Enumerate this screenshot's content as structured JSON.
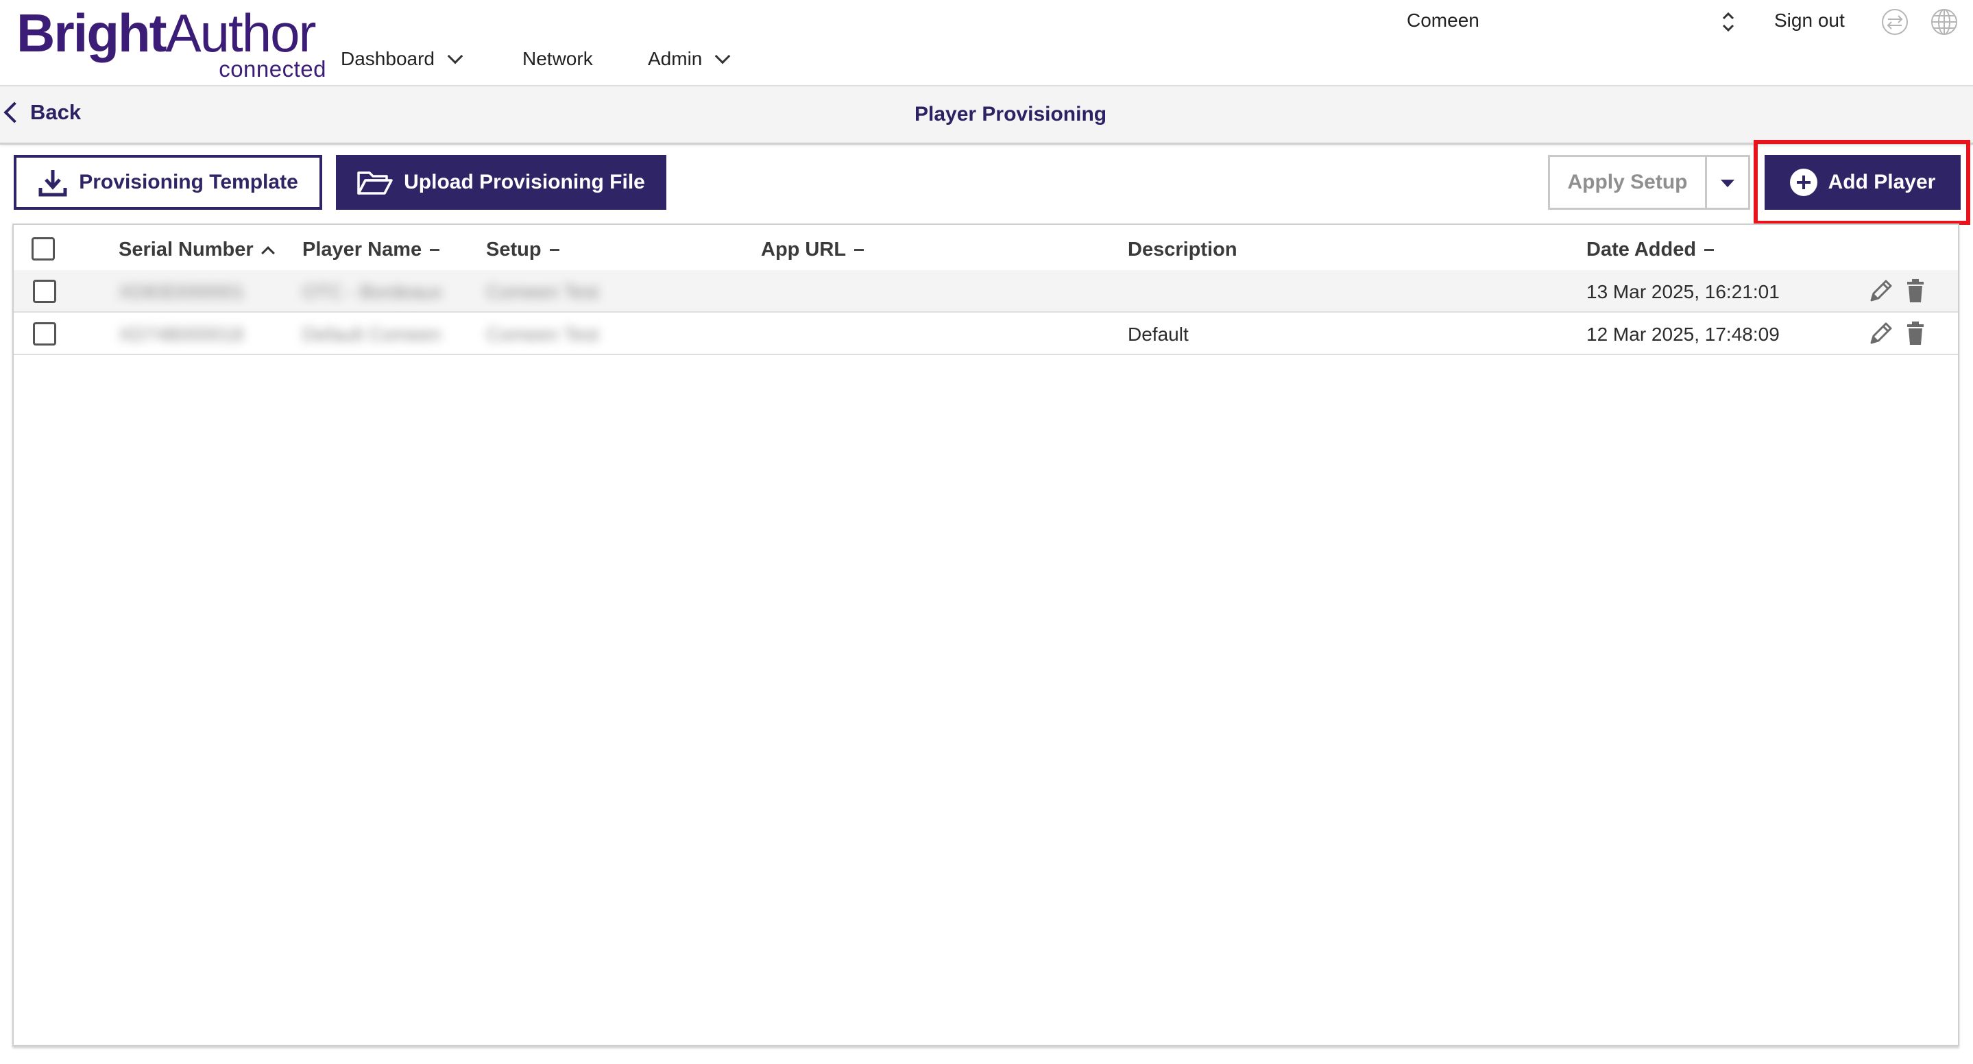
{
  "header": {
    "logo_bold": "Bright",
    "logo_light": "Author",
    "logo_sub": "connected",
    "nav": [
      {
        "label": "Dashboard",
        "dropdown": true
      },
      {
        "label": "Network",
        "dropdown": false
      },
      {
        "label": "Admin",
        "dropdown": true
      }
    ],
    "account_name": "Comeen",
    "sign_out": "Sign out",
    "icons": [
      "account-switch-icon",
      "sync-icon",
      "globe-icon"
    ]
  },
  "subheader": {
    "back_label": "Back",
    "title": "Player Provisioning"
  },
  "toolbar": {
    "template_label": "Provisioning Template",
    "upload_label": "Upload Provisioning File",
    "apply_label": "Apply Setup",
    "add_label": "Add Player"
  },
  "table": {
    "columns": [
      {
        "label": "Serial Number",
        "sort": "asc"
      },
      {
        "label": "Player Name",
        "sort": "none"
      },
      {
        "label": "Setup",
        "sort": "none"
      },
      {
        "label": "App URL",
        "sort": "none"
      },
      {
        "label": "Description",
        "sort": null
      },
      {
        "label": "Date Added",
        "sort": "none"
      }
    ],
    "rows": [
      {
        "serial": "XD83D000001",
        "name": "OTC - Bordeaux",
        "setup": "Comeen Test",
        "app_url": "",
        "description": "",
        "date": "13 Mar 2025, 16:21:01"
      },
      {
        "serial": "XD74B000018",
        "name": "Default Comeen",
        "setup": "Comeen Test",
        "app_url": "",
        "description": "Default",
        "date": "12 Mar 2025, 17:48:09"
      }
    ]
  },
  "colors": {
    "brand": "#2f2466",
    "logo": "#3b1d78",
    "highlight": "#e8141c"
  }
}
